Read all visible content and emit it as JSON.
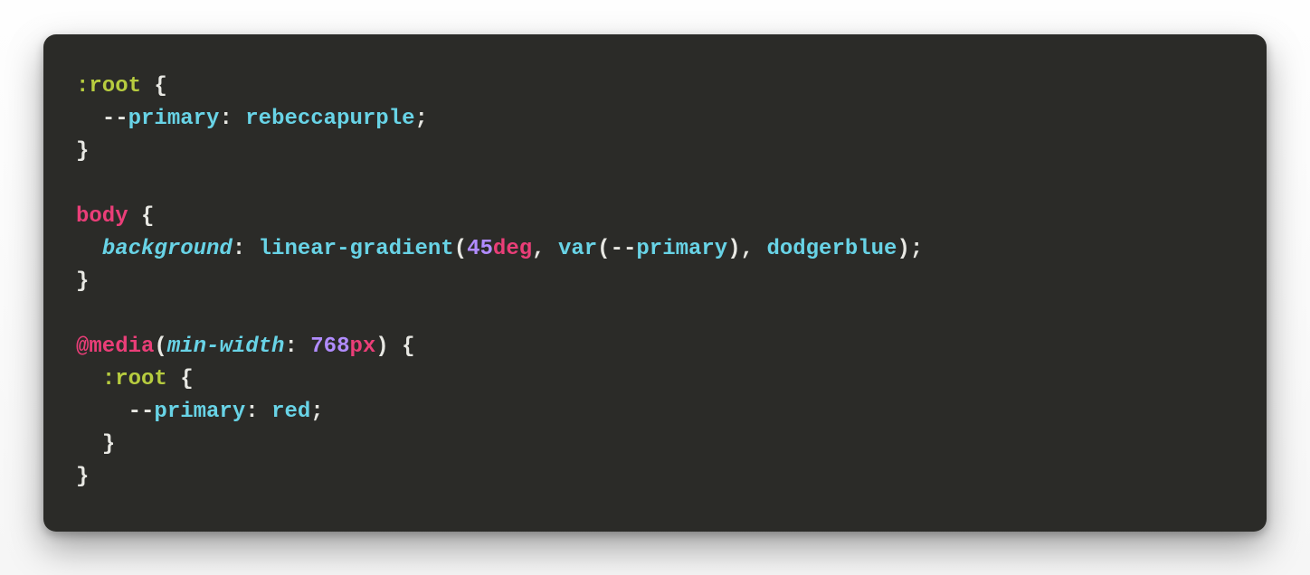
{
  "code": {
    "tokens": [
      {
        "c": "tok-sel",
        "t": ":root"
      },
      {
        "c": "tok-pun",
        "t": " {"
      },
      {
        "c": "",
        "t": "\n  "
      },
      {
        "c": "tok-pun",
        "t": "--"
      },
      {
        "c": "tok-val",
        "t": "primary"
      },
      {
        "c": "tok-pun",
        "t": ": "
      },
      {
        "c": "tok-val",
        "t": "rebeccapurple"
      },
      {
        "c": "tok-pun",
        "t": ";"
      },
      {
        "c": "",
        "t": "\n"
      },
      {
        "c": "tok-pun",
        "t": "}"
      },
      {
        "c": "",
        "t": "\n\n"
      },
      {
        "c": "tok-tag",
        "t": "body"
      },
      {
        "c": "tok-pun",
        "t": " {"
      },
      {
        "c": "",
        "t": "\n  "
      },
      {
        "c": "tok-prop",
        "t": "background"
      },
      {
        "c": "tok-pun",
        "t": ": "
      },
      {
        "c": "tok-val",
        "t": "linear-gradient"
      },
      {
        "c": "tok-pun",
        "t": "("
      },
      {
        "c": "tok-num",
        "t": "45"
      },
      {
        "c": "tok-unit",
        "t": "deg"
      },
      {
        "c": "tok-pun",
        "t": ", "
      },
      {
        "c": "tok-val",
        "t": "var"
      },
      {
        "c": "tok-pun",
        "t": "(--"
      },
      {
        "c": "tok-val",
        "t": "primary"
      },
      {
        "c": "tok-pun",
        "t": "), "
      },
      {
        "c": "tok-val",
        "t": "dodgerblue"
      },
      {
        "c": "tok-pun",
        "t": ");"
      },
      {
        "c": "",
        "t": "\n"
      },
      {
        "c": "tok-pun",
        "t": "}"
      },
      {
        "c": "",
        "t": "\n\n"
      },
      {
        "c": "tok-tag",
        "t": "@media"
      },
      {
        "c": "tok-pun",
        "t": "("
      },
      {
        "c": "tok-feat",
        "t": "min-width"
      },
      {
        "c": "tok-pun",
        "t": ": "
      },
      {
        "c": "tok-num",
        "t": "768"
      },
      {
        "c": "tok-unit",
        "t": "px"
      },
      {
        "c": "tok-pun",
        "t": ") {"
      },
      {
        "c": "",
        "t": "\n  "
      },
      {
        "c": "tok-sel",
        "t": ":root"
      },
      {
        "c": "tok-pun",
        "t": " {"
      },
      {
        "c": "",
        "t": "\n    "
      },
      {
        "c": "tok-pun",
        "t": "--"
      },
      {
        "c": "tok-val",
        "t": "primary"
      },
      {
        "c": "tok-pun",
        "t": ": "
      },
      {
        "c": "tok-val",
        "t": "red"
      },
      {
        "c": "tok-pun",
        "t": ";"
      },
      {
        "c": "",
        "t": "\n  "
      },
      {
        "c": "tok-pun",
        "t": "}"
      },
      {
        "c": "",
        "t": "\n"
      },
      {
        "c": "tok-pun",
        "t": "}"
      }
    ]
  }
}
